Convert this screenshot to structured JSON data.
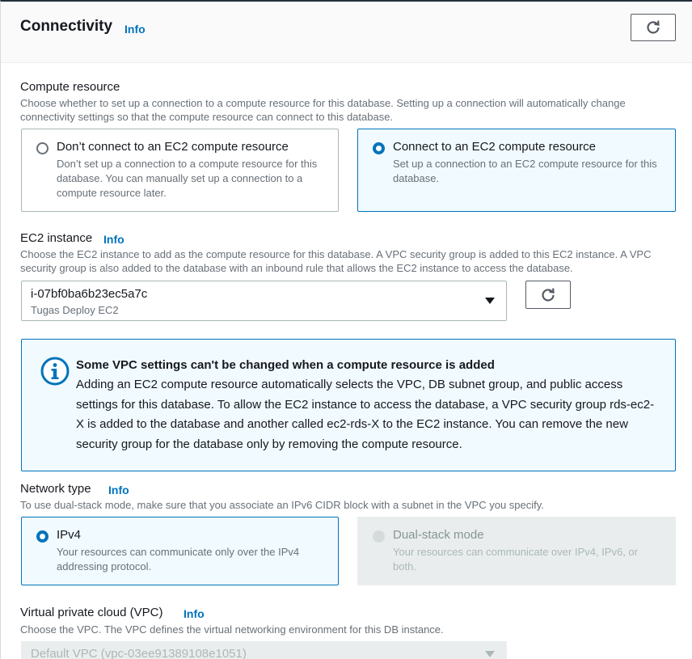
{
  "header": {
    "title": "Connectivity",
    "info": "Info"
  },
  "compute_resource": {
    "label": "Compute resource",
    "description": "Choose whether to set up a connection to a compute resource for this database. Setting up a connection will automatically change connectivity settings so that the compute resource can connect to this database.",
    "options": [
      {
        "title": "Don’t connect to an EC2 compute resource",
        "description": "Don’t set up a connection to a compute resource for this database. You can manually set up a connection to a compute resource later.",
        "selected": false
      },
      {
        "title": "Connect to an EC2 compute resource",
        "description": "Set up a connection to an EC2 compute resource for this database.",
        "selected": true
      }
    ]
  },
  "ec2_instance": {
    "label": "EC2 instance",
    "info": "Info",
    "description": "Choose the EC2 instance to add as the compute resource for this database. A VPC security group is added to this EC2 instance. A VPC security group is also added to the database with an inbound rule that allows the EC2 instance to access the database.",
    "selected_value": "i-07bf0ba6b23ec5a7c",
    "selected_sublabel": "Tugas Deploy EC2"
  },
  "alert": {
    "icon": "info-circle-icon",
    "title": "Some VPC settings can't be changed when a compute resource is added",
    "body": "Adding an EC2 compute resource automatically selects the VPC, DB subnet group, and public access settings for this database. To allow the EC2 instance to access the database, a VPC security group rds-ec2-X is added to the database and another called ec2-rds-X to the EC2 instance. You can remove the new security group for the database only by removing the compute resource."
  },
  "network_type": {
    "label": "Network type",
    "info": "Info",
    "description": "To use dual-stack mode, make sure that you associate an IPv6 CIDR block with a subnet in the VPC you specify.",
    "options": [
      {
        "title": "IPv4",
        "description": "Your resources can communicate only over the IPv4 addressing protocol.",
        "selected": true,
        "disabled": false
      },
      {
        "title": "Dual-stack mode",
        "description": "Your resources can communicate over IPv4, IPv6, or both.",
        "selected": false,
        "disabled": true
      }
    ]
  },
  "vpc": {
    "label": "Virtual private cloud (VPC)",
    "info": "Info",
    "description": "Choose the VPC. The VPC defines the virtual networking environment for this DB instance.",
    "selected_value": "Default VPC (vpc-03ee91389108e1051)"
  },
  "colors": {
    "accent": "#0073bb",
    "selected_bg": "#f1faff",
    "disabled_bg": "#eaeded"
  }
}
